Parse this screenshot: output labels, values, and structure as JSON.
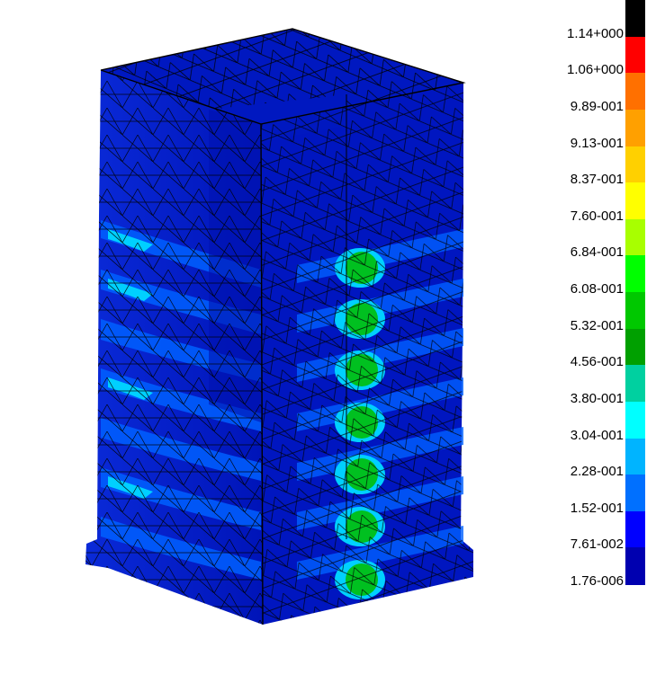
{
  "legend": {
    "labels": [
      "1.14+000",
      "1.06+000",
      "9.89-001",
      "9.13-001",
      "8.37-001",
      "7.60-001",
      "6.84-001",
      "6.08-001",
      "5.32-001",
      "4.56-001",
      "3.80-001",
      "3.04-001",
      "2.28-001",
      "1.52-001",
      "7.61-002",
      "1.76-006"
    ],
    "colors": [
      "#000000",
      "#ff0000",
      "#ff7000",
      "#ffa000",
      "#ffd000",
      "#ffff00",
      "#a8ff00",
      "#00ff00",
      "#00c800",
      "#00a000",
      "#00d0a0",
      "#00ffff",
      "#00b4ff",
      "#0070ff",
      "#0000ff",
      "#0000b0"
    ]
  },
  "model": {
    "base_color": "#0018c8",
    "stress_colors": [
      "#0050ff",
      "#0090ff",
      "#00d0ff",
      "#30ff80",
      "#00c020"
    ],
    "mesh_color": "#000000"
  }
}
